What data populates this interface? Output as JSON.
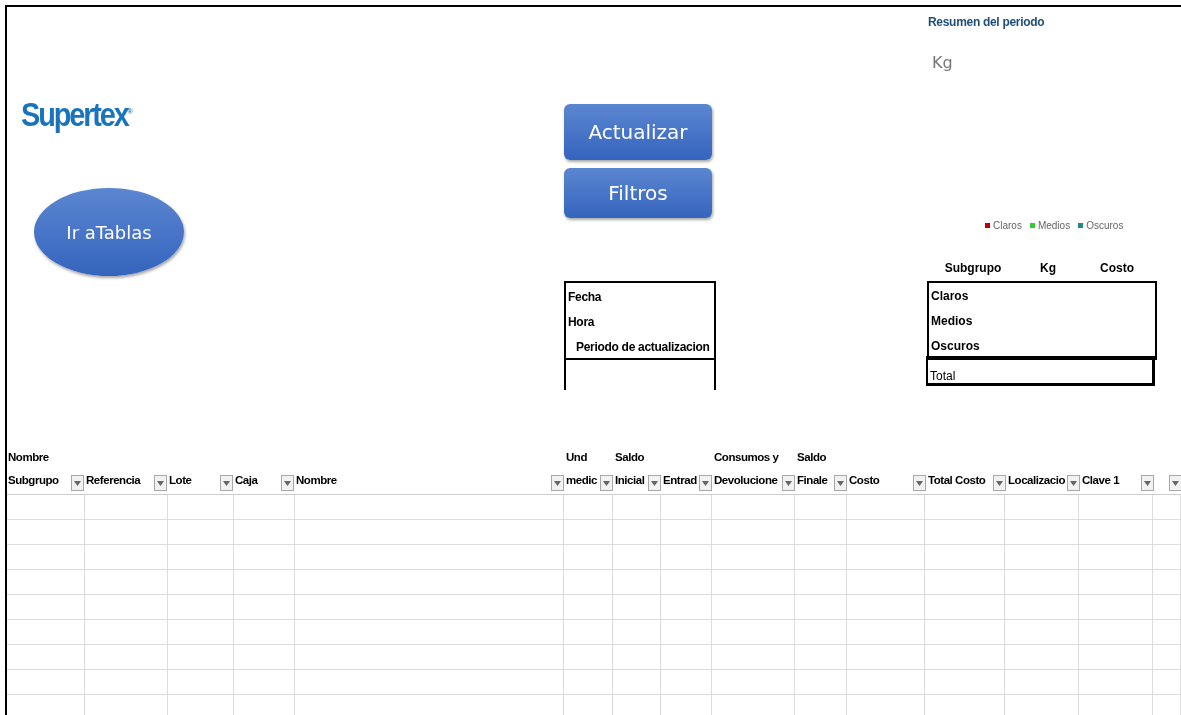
{
  "logo": {
    "text": "Supertex$^{®}$"
  },
  "buttons": [
    {
      "label": "Ir aTablas",
      "kind": "oval"
    },
    {
      "label": "Actualizar",
      "kind": "rect"
    },
    {
      "label": "Filtros",
      "kind": "rect"
    }
  ],
  "info_box": {
    "rows": [
      "Fecha",
      "Hora",
      "Periodo de actualizacion"
    ]
  },
  "chart": {
    "title": "Resumen del periodo",
    "subtitle": "Kg",
    "legend": [
      {
        "label": "Claros",
        "color": "#c00000"
      },
      {
        "label": "Medios",
        "color": "#33cc33"
      },
      {
        "label": "Oscuros",
        "color": "#1f8a8a"
      }
    ]
  },
  "summary_table": {
    "columns": [
      "Subgrupo",
      "Kg",
      "Costo"
    ],
    "rows": [
      "Claros",
      "Medios",
      "Oscuros"
    ],
    "total": "Total"
  },
  "table": {
    "columns": [
      {
        "label": [
          "Nombre",
          "Subgrupo"
        ],
        "filter": true
      },
      {
        "label": [
          "Referencia"
        ],
        "filter": true
      },
      {
        "label": [
          "Lote"
        ],
        "filter": true
      },
      {
        "label": [
          "Caja"
        ],
        "filter": true
      },
      {
        "label": [
          "Nombre"
        ],
        "filter": true
      },
      {
        "label": [
          "Und",
          "medic"
        ],
        "filter": true
      },
      {
        "label": [
          "Saldo",
          "Inicial"
        ],
        "filter": true
      },
      {
        "label": [
          "Entrad"
        ],
        "filter": true
      },
      {
        "label": [
          "Consumos y",
          "Devolucione"
        ],
        "filter": true
      },
      {
        "label": [
          "Saldo",
          "Finale"
        ],
        "filter": true
      },
      {
        "label": [
          "Costo"
        ],
        "filter": true
      },
      {
        "label": [
          "Total Costo"
        ],
        "filter": true
      },
      {
        "label": [
          "Localizacio"
        ],
        "filter": true
      },
      {
        "label": [
          "Clave 1"
        ],
        "filter": true
      },
      {
        "filter": true
      }
    ]
  }
}
